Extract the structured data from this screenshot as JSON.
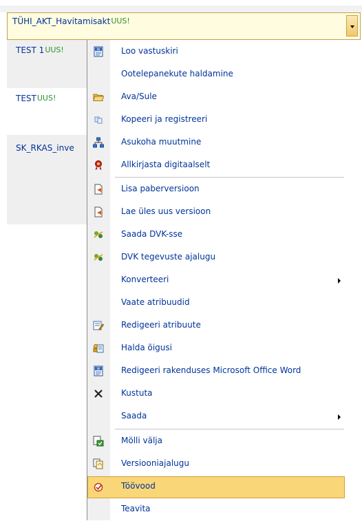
{
  "document_list": {
    "selected": {
      "title": "TÜHI_AKT_Havitamisakt",
      "badge": "UUS!"
    },
    "rows": [
      {
        "title": "TEST 1",
        "badge": "UUS!"
      },
      {
        "title": "TEST",
        "badge": "UUS!"
      },
      {
        "title": "SK_RKAS_inve",
        "badge": ""
      }
    ]
  },
  "context_menu": {
    "items": [
      {
        "label": "Loo vastuskiri",
        "icon": "word-document-icon"
      },
      {
        "label": "Ootelepanekute haldamine",
        "icon": ""
      },
      {
        "label": "Ava/Sule",
        "icon": "open-folder-icon"
      },
      {
        "label": "Kopeeri ja registreeri",
        "icon": "copy-icon"
      },
      {
        "label": "Asukoha muutmine",
        "icon": "hierarchy-icon"
      },
      {
        "label": "Allkirjasta digitaalselt",
        "icon": "award-ribbon-icon"
      },
      {
        "label": "Lisa paberversioon",
        "icon": "document-arrow-icon"
      },
      {
        "label": "Lae üles uus versioon",
        "icon": "document-arrow-icon"
      },
      {
        "label": "Saada DVK-sse",
        "icon": "dvk-send-icon"
      },
      {
        "label": "DVK tegevuste ajalugu",
        "icon": "dvk-send-icon"
      },
      {
        "label": "Konverteeri",
        "icon": ""
      },
      {
        "label": "Vaate atribuudid",
        "icon": ""
      },
      {
        "label": "Redigeeri atribuute",
        "icon": "edit-properties-icon"
      },
      {
        "label": "Halda õigusi",
        "icon": "permissions-icon"
      },
      {
        "label": "Redigeeri rakenduses Microsoft Office Word",
        "icon": "word-document-icon"
      },
      {
        "label": "Kustuta",
        "icon": "delete-x-icon"
      },
      {
        "label": "Saada",
        "icon": ""
      },
      {
        "label": "Mölli välja",
        "icon": "check-out-icon"
      },
      {
        "label": "Versiooniajalugu",
        "icon": "version-history-icon"
      },
      {
        "label": "Töövood",
        "icon": "workflow-icon"
      },
      {
        "label": "Teavita",
        "icon": ""
      }
    ]
  }
}
